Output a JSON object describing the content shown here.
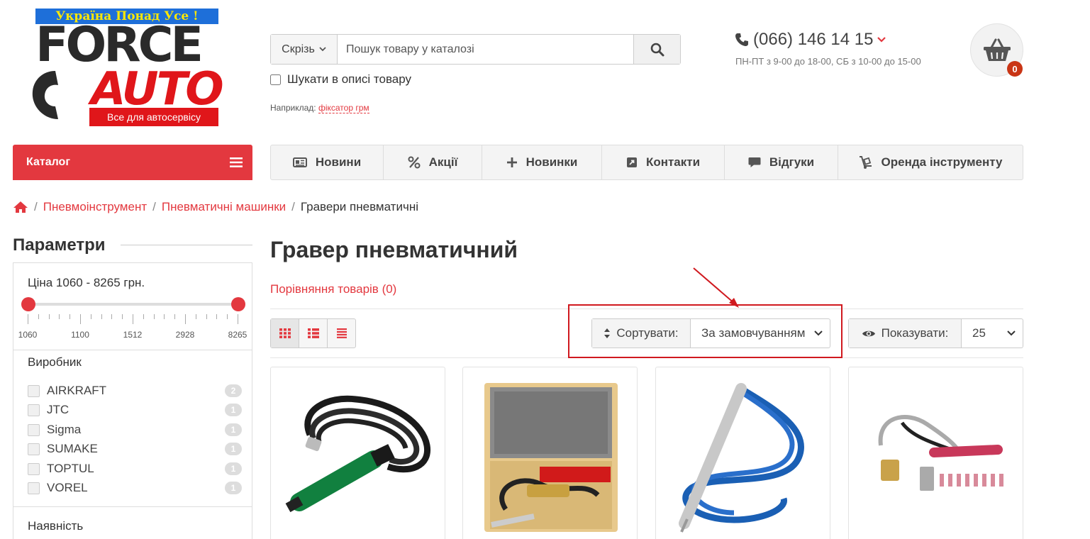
{
  "logo": {
    "slogan": "Україна Понад Усе !",
    "word1": "FORCE",
    "word2": "AUTO",
    "tagline": "Все для автосервісу"
  },
  "search": {
    "scope": "Скрізь",
    "placeholder": "Пошук товару у каталозі",
    "desc_checkbox": "Шукати в описі товару",
    "example_label": "Наприклад:",
    "example_link": "фіксатор грм"
  },
  "contacts": {
    "phone": "(066) 146 14 15",
    "hours": "ПН-ПТ з 9-00 до 18-00, СБ з 10-00 до 15-00"
  },
  "cart": {
    "count": "0"
  },
  "catalog": {
    "label": "Каталог"
  },
  "nav": [
    {
      "label": "Новини",
      "icon": "newspaper-icon"
    },
    {
      "label": "Акції",
      "icon": "percent-icon"
    },
    {
      "label": "Новинки",
      "icon": "plus-icon"
    },
    {
      "label": "Контакти",
      "icon": "contact-icon"
    },
    {
      "label": "Відгуки",
      "icon": "comment-icon"
    },
    {
      "label": "Оренда інструменту",
      "icon": "dolly-icon"
    }
  ],
  "breadcrumb": {
    "items": [
      "Пневмоінструмент",
      "Пневматичні машинки"
    ],
    "current": "Гравери пневматичні"
  },
  "sidebar": {
    "title": "Параметри",
    "price_label": "Ціна 1060 - 8265 грн.",
    "slider_ticks": [
      "1060",
      "1100",
      "1512",
      "2928",
      "8265"
    ],
    "manufacturer_title": "Виробник",
    "brands": [
      {
        "name": "AIRKRAFT",
        "count": "2"
      },
      {
        "name": "JTC",
        "count": "1"
      },
      {
        "name": "Sigma",
        "count": "1"
      },
      {
        "name": "SUMAKE",
        "count": "1"
      },
      {
        "name": "TOPTUL",
        "count": "1"
      },
      {
        "name": "VOREL",
        "count": "1"
      }
    ],
    "availability_title": "Наявність"
  },
  "main": {
    "title": "Гравер пневматичний",
    "compare_link": "Порівняння товарів (0)",
    "sort_label": "Сортувати:",
    "sort_value": "За замовчуванням",
    "show_label": "Показувати:",
    "show_value": "25"
  },
  "colors": {
    "accent": "#e3383f",
    "highlight": "#d0191f"
  }
}
